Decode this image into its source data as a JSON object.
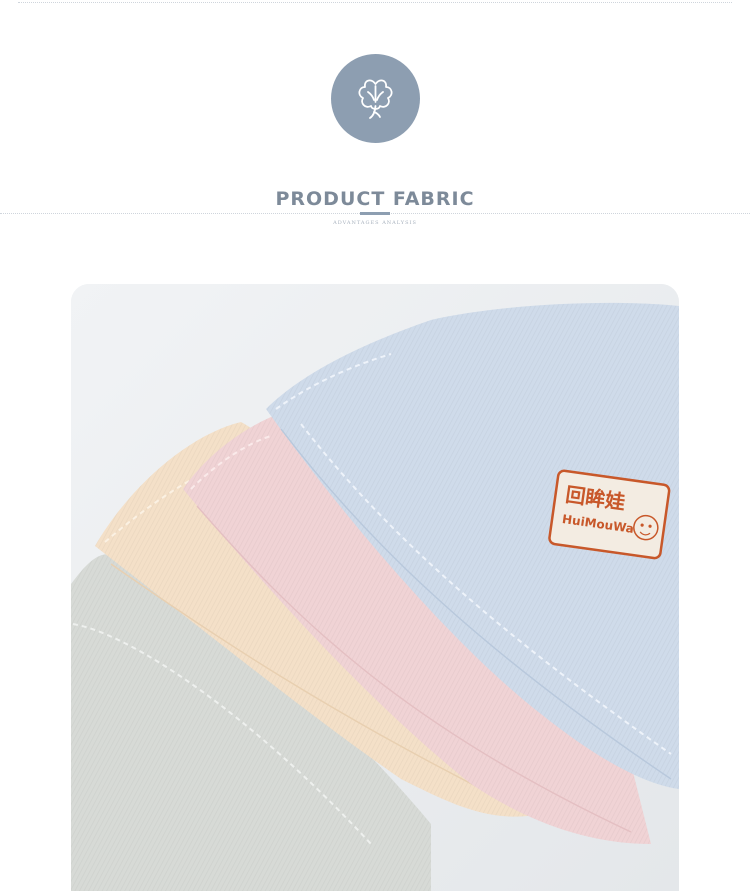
{
  "section": {
    "icon": "cotton-icon",
    "title": "PRODUCT FABRIC",
    "subtitle": "ADVANTAGES ANALYSIS"
  },
  "colors": {
    "accent": "#8d9eb1",
    "title": "#7d8a99",
    "hat_blue": "#cfdbea",
    "hat_pink": "#f0d3d5",
    "hat_peach": "#f4e0c8",
    "hat_grey": "#d7dad6",
    "label": "#c8582a"
  },
  "product": {
    "label_chinese": "回眸娃",
    "label_latin": "HuiMouWa"
  }
}
